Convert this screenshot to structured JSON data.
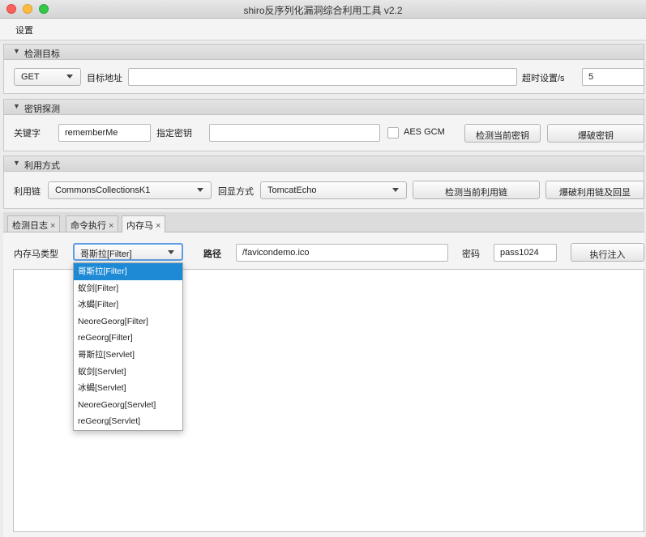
{
  "window": {
    "title": "shiro反序列化漏洞综合利用工具 v2.2"
  },
  "menu": {
    "settings": "设置"
  },
  "target": {
    "header": "检测目标",
    "method": "GET",
    "url_label": "目标地址",
    "url_value": "",
    "timeout_label": "超时设置/s",
    "timeout_value": "5"
  },
  "key": {
    "header": "密钥探测",
    "keyword_label": "关键字",
    "keyword_value": "rememberMe",
    "specify_label": "指定密钥",
    "specify_value": "",
    "aes_gcm_label": "AES GCM",
    "aes_gcm_checked": false,
    "detect_button": "检测当前密钥",
    "brute_button": "爆破密钥"
  },
  "exploit": {
    "header": "利用方式",
    "chain_label": "利用链",
    "chain_value": "CommonsCollectionsK1",
    "echo_label": "回显方式",
    "echo_value": "TomcatEcho",
    "detect_button": "检测当前利用链",
    "brute_button": "爆破利用链及回显"
  },
  "tabs": [
    {
      "label": "检测日志",
      "close": "×"
    },
    {
      "label": "命令执行",
      "close": "×"
    },
    {
      "label": "内存马",
      "close": "×"
    }
  ],
  "memshell": {
    "type_label": "内存马类型",
    "type_value": "哥斯拉[Filter]",
    "path_label": "路径",
    "path_value": "/favicondemo.ico",
    "password_label": "密码",
    "password_value": "pass1024",
    "inject_button": "执行注入",
    "options": [
      "哥斯拉[Filter]",
      "蚁剑[Filter]",
      "冰蝎[Filter]",
      "NeoreGeorg[Filter]",
      "reGeorg[Filter]",
      "哥斯拉[Servlet]",
      "蚁剑[Servlet]",
      "冰蝎[Servlet]",
      "NeoreGeorg[Servlet]",
      "reGeorg[Servlet]"
    ],
    "selected_index": 0
  }
}
